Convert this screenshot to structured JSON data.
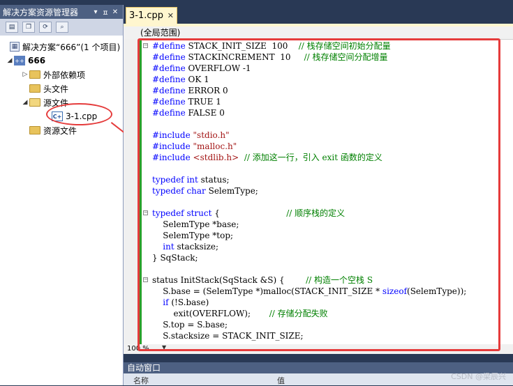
{
  "solution_explorer": {
    "title": "解决方案资源管理器",
    "title_controls": [
      "▾",
      "ㅍ",
      "✕"
    ],
    "toolbar_icons": [
      "properties-icon",
      "show-all-files-icon",
      "refresh-icon",
      "view-class-diagram-icon"
    ],
    "tree": {
      "solution": "解决方案“666”(1 个项目)",
      "project": "666",
      "external_deps": "外部依赖项",
      "headers": "头文件",
      "sources": "源文件",
      "file": "3-1.cpp",
      "resources": "资源文件"
    }
  },
  "editor": {
    "tab_label": "3-1.cpp",
    "scope": "(全局范围)",
    "zoom": "100 %",
    "code_lines": [
      {
        "fold": "⊟",
        "parts": [
          {
            "k": "kw",
            "t": "#define"
          },
          {
            "k": "n",
            "t": " STACK_INIT_SIZE  100    "
          },
          {
            "k": "cm",
            "t": "// 栈存储空间初始分配量"
          }
        ]
      },
      {
        "fold": "",
        "parts": [
          {
            "k": "kw",
            "t": "#define"
          },
          {
            "k": "n",
            "t": " STACKINCREMENT  10     "
          },
          {
            "k": "cm",
            "t": "// 栈存储空间分配增量"
          }
        ]
      },
      {
        "fold": "",
        "parts": [
          {
            "k": "kw",
            "t": "#define"
          },
          {
            "k": "n",
            "t": " OVERFLOW -1"
          }
        ]
      },
      {
        "fold": "",
        "parts": [
          {
            "k": "kw",
            "t": "#define"
          },
          {
            "k": "n",
            "t": " OK 1"
          }
        ]
      },
      {
        "fold": "",
        "parts": [
          {
            "k": "kw",
            "t": "#define"
          },
          {
            "k": "n",
            "t": " ERROR 0"
          }
        ]
      },
      {
        "fold": "",
        "parts": [
          {
            "k": "kw",
            "t": "#define"
          },
          {
            "k": "n",
            "t": " TRUE 1"
          }
        ]
      },
      {
        "fold": "",
        "parts": [
          {
            "k": "kw",
            "t": "#define"
          },
          {
            "k": "n",
            "t": " FALSE 0"
          }
        ]
      },
      {
        "fold": "",
        "parts": []
      },
      {
        "fold": "",
        "parts": [
          {
            "k": "kw",
            "t": "#include"
          },
          {
            "k": "n",
            "t": " "
          },
          {
            "k": "st",
            "t": "\"stdio.h\""
          }
        ]
      },
      {
        "fold": "",
        "parts": [
          {
            "k": "kw",
            "t": "#include"
          },
          {
            "k": "n",
            "t": " "
          },
          {
            "k": "st",
            "t": "\"malloc.h\""
          }
        ]
      },
      {
        "fold": "",
        "parts": [
          {
            "k": "kw",
            "t": "#include"
          },
          {
            "k": "n",
            "t": " "
          },
          {
            "k": "st",
            "t": "<stdlib.h>"
          },
          {
            "k": "n",
            "t": "  "
          },
          {
            "k": "cm",
            "t": "// 添加这一行，引入 exit 函数的定义"
          }
        ]
      },
      {
        "fold": "",
        "parts": []
      },
      {
        "fold": "",
        "parts": [
          {
            "k": "kw",
            "t": "typedef"
          },
          {
            "k": "n",
            "t": " "
          },
          {
            "k": "kw",
            "t": "int"
          },
          {
            "k": "n",
            "t": " status;"
          }
        ]
      },
      {
        "fold": "",
        "parts": [
          {
            "k": "kw",
            "t": "typedef"
          },
          {
            "k": "n",
            "t": " "
          },
          {
            "k": "kw",
            "t": "char"
          },
          {
            "k": "n",
            "t": " SelemType;"
          }
        ]
      },
      {
        "fold": "",
        "parts": []
      },
      {
        "fold": "⊟",
        "parts": [
          {
            "k": "kw",
            "t": "typedef"
          },
          {
            "k": "n",
            "t": " "
          },
          {
            "k": "kw",
            "t": "struct"
          },
          {
            "k": "n",
            "t": " {                         "
          },
          {
            "k": "cm",
            "t": "// 顺序栈的定义"
          }
        ]
      },
      {
        "fold": "",
        "parts": [
          {
            "k": "n",
            "t": "    SelemType *base;"
          }
        ]
      },
      {
        "fold": "",
        "parts": [
          {
            "k": "n",
            "t": "    SelemType *top;"
          }
        ]
      },
      {
        "fold": "",
        "parts": [
          {
            "k": "n",
            "t": "    "
          },
          {
            "k": "kw",
            "t": "int"
          },
          {
            "k": "n",
            "t": " stacksize;"
          }
        ]
      },
      {
        "fold": "",
        "parts": [
          {
            "k": "n",
            "t": "} SqStack;"
          }
        ]
      },
      {
        "fold": "",
        "parts": []
      },
      {
        "fold": "⊟",
        "parts": [
          {
            "k": "n",
            "t": "status InitStack(SqStack &S) {        "
          },
          {
            "k": "cm",
            "t": "// 构造一个空栈 S"
          }
        ]
      },
      {
        "fold": "",
        "parts": [
          {
            "k": "n",
            "t": "    S.base = (SelemType *)malloc(STACK_INIT_SIZE * "
          },
          {
            "k": "kw",
            "t": "sizeof"
          },
          {
            "k": "n",
            "t": "(SelemType));"
          }
        ]
      },
      {
        "fold": "",
        "parts": [
          {
            "k": "n",
            "t": "    "
          },
          {
            "k": "kw",
            "t": "if"
          },
          {
            "k": "n",
            "t": " (!S.base)"
          }
        ]
      },
      {
        "fold": "",
        "parts": [
          {
            "k": "n",
            "t": "        exit(OVERFLOW);       "
          },
          {
            "k": "cm",
            "t": "// 存储分配失败"
          }
        ]
      },
      {
        "fold": "",
        "parts": [
          {
            "k": "n",
            "t": "    S.top = S.base;"
          }
        ]
      },
      {
        "fold": "",
        "parts": [
          {
            "k": "n",
            "t": "    S.stacksize = STACK_INIT_SIZE;"
          }
        ]
      }
    ]
  },
  "auto_window": {
    "title": "自动窗口",
    "col_name": "名称",
    "col_value": "值"
  },
  "watermark": "CSDN @梁辰兴"
}
